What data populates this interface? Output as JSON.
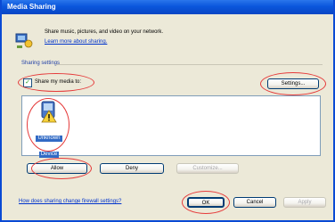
{
  "window": {
    "title": "Media Sharing"
  },
  "info": {
    "description": "Share music, pictures, and video on your network.",
    "learn_more_link": "Learn more about sharing."
  },
  "sharing_settings": {
    "group_label": "Sharing settings",
    "share_checkbox_label": "Share my media to:",
    "share_checked": true,
    "settings_button": "Settings..."
  },
  "device_list": {
    "devices": [
      {
        "label_line1": "Unknown",
        "label_line2": "Device",
        "icon": "unknown-device-warning-icon"
      }
    ]
  },
  "device_actions": {
    "allow_button": "Allow",
    "deny_button": "Deny",
    "customize_button": "Customize..."
  },
  "footer": {
    "firewall_link": "How does sharing change firewall settings?",
    "ok_button": "OK",
    "cancel_button": "Cancel",
    "apply_button": "Apply"
  },
  "colors": {
    "title_bar": "#0a56dc",
    "dialog_bg": "#ece9d8",
    "link": "#0033cc",
    "highlight_circle": "#e53a3a",
    "selection": "#316ac5"
  }
}
